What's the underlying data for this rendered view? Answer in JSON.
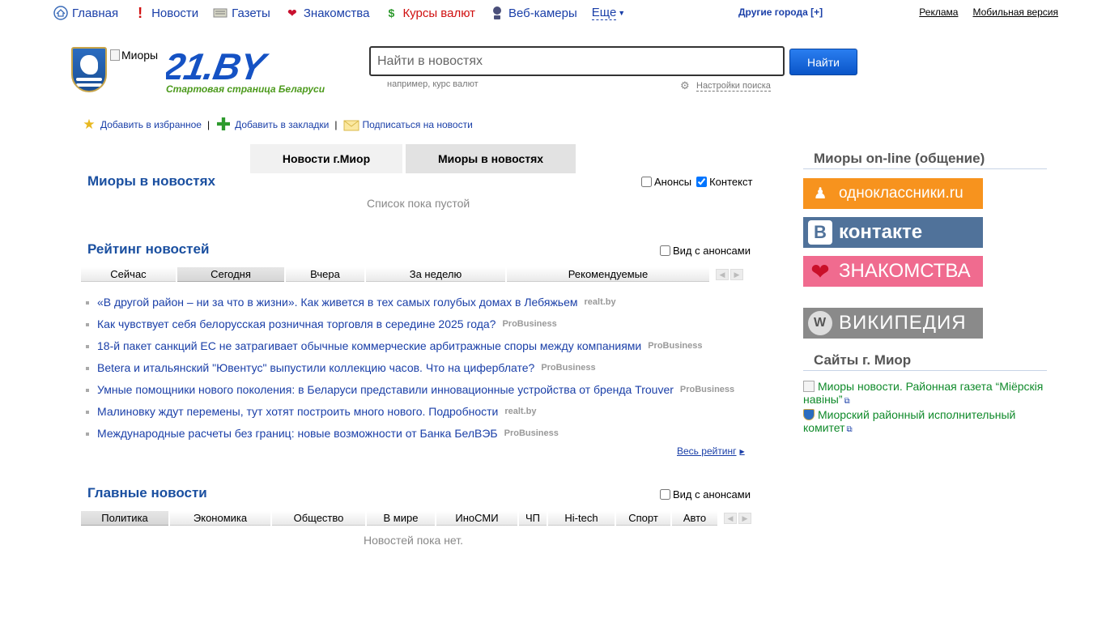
{
  "topnav": {
    "items": [
      {
        "label": "Главная",
        "icon": "home-icon"
      },
      {
        "label": "Новости",
        "icon": "exclamation-icon"
      },
      {
        "label": "Газеты",
        "icon": "newspaper-icon"
      },
      {
        "label": "Знакомства",
        "icon": "heart-icon"
      },
      {
        "label": "Курсы валют",
        "icon": "dollar-icon"
      },
      {
        "label": "Веб-камеры",
        "icon": "webcam-icon"
      },
      {
        "label": "Еще"
      }
    ],
    "other_cities": "Другие города [+]",
    "ads": "Реклама",
    "mobile": "Мобильная версия"
  },
  "header": {
    "city_img_alt": "Миоры",
    "logo_text": "21.BY",
    "tagline": "Стартовая страница Беларуси"
  },
  "search": {
    "placeholder": "Найти в новостях",
    "button": "Найти",
    "hint": "например, курс валют",
    "settings": "Настройки поиска"
  },
  "actions": {
    "favorites": "Добавить в избранное",
    "bookmarks": "Добавить в закладки",
    "subscribe": "Подписаться на новости",
    "sep": "|"
  },
  "source_tabs": [
    "Новости г.Миор",
    "Миоры в новостях"
  ],
  "in_news": {
    "title": "Миоры в новостях",
    "check_announces": "Анонсы",
    "check_context": "Контекст",
    "empty": "Список пока пустой"
  },
  "rating": {
    "title": "Рейтинг новостей",
    "check_label": "Вид с анонсами",
    "tabs": [
      "Сейчас",
      "Сегодня",
      "Вчера",
      "За неделю",
      "Рекомендуемые"
    ],
    "items": [
      {
        "title": "«В другой район – ни за что в жизни». Как живется в тех самых голубых домах в Лебяжьем",
        "source": "realt.by"
      },
      {
        "title": "Как чувствует себя белорусская розничная торговля в середине 2025 года?",
        "source": "ProBusiness"
      },
      {
        "title": "18-й пакет санкций ЕС не затрагивает обычные коммерческие арбитражные споры между компаниями",
        "source": "ProBusiness"
      },
      {
        "title": "Betera и итальянский \"Ювентус\" выпустили коллекцию часов. Что на циферблате?",
        "source": "ProBusiness"
      },
      {
        "title": "Умные помощники нового поколения: в Беларуси представили инновационные устройства от бренда Trouver",
        "source": "ProBusiness"
      },
      {
        "title": "Малиновку ждут перемены, тут хотят построить много нового. Подробности",
        "source": "realt.by"
      },
      {
        "title": "Международные расчеты без границ: новые возможности от Банка БелВЭБ",
        "source": "ProBusiness"
      }
    ],
    "all_link": "Весь рейтинг"
  },
  "main_news": {
    "title": "Главные новости",
    "check_label": "Вид с анонсами",
    "tabs": [
      "Политика",
      "Экономика",
      "Общество",
      "В мире",
      "ИноСМИ",
      "ЧП",
      "Hi-tech",
      "Спорт",
      "Авто"
    ],
    "empty": "Новостей пока нет."
  },
  "sidebar": {
    "online_title": "Миоры on-line (общение)",
    "banners": [
      {
        "label": "одноклассники.ru",
        "icon": "odnoklassniki-icon"
      },
      {
        "label": "контакте",
        "icon": "vk-icon"
      },
      {
        "label": "ЗНАКОМСТВА",
        "icon": "heart-icon"
      },
      {
        "label": "ВИКИПЕДИЯ",
        "icon": "wikipedia-icon"
      }
    ],
    "sites_title": "Сайты г. Миор",
    "sites": [
      {
        "label": "Миоры новости. Районная газета “Мiёрскiя навiны”"
      },
      {
        "label": "Миорский районный исполнительный комитет"
      }
    ]
  }
}
